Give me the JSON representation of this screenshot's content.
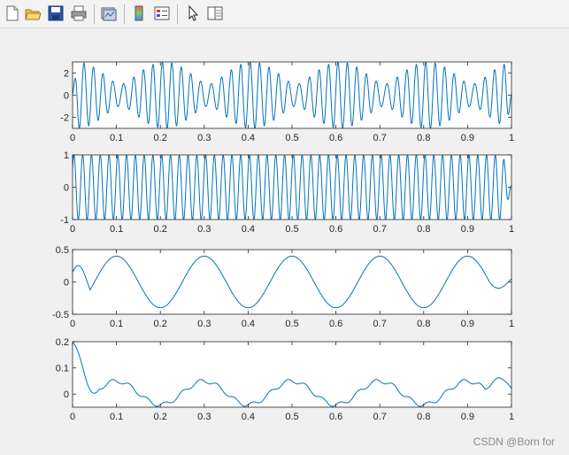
{
  "toolbar": {
    "buttons": [
      {
        "name": "new-figure-icon"
      },
      {
        "name": "open-file-icon"
      },
      {
        "name": "save-figure-icon"
      },
      {
        "name": "print-figure-icon"
      },
      {
        "name": "link-plot-icon"
      },
      {
        "name": "insert-colorbar-icon"
      },
      {
        "name": "insert-legend-icon"
      },
      {
        "name": "edit-plot-icon"
      },
      {
        "name": "open-property-inspector-icon"
      }
    ]
  },
  "watermark": "CSDN @Born for",
  "chart_data": [
    {
      "type": "line",
      "title": "",
      "xlabel": "",
      "ylabel": "",
      "xlim": [
        0,
        1
      ],
      "ylim": [
        -3,
        3
      ],
      "xticks": [
        0,
        0.1,
        0.2,
        0.3,
        0.4,
        0.5,
        0.6,
        0.7,
        0.8,
        0.9,
        1
      ],
      "xtick_labels": [
        "0",
        "0.1",
        "0.2",
        "0.3",
        "0.4",
        "0.5",
        "0.6",
        "0.7",
        "0.8",
        "0.9",
        "1"
      ],
      "yticks": [
        -2,
        0,
        2
      ],
      "ytick_labels": [
        "-2",
        "0",
        "2"
      ],
      "color": "#0072bd",
      "series": [
        {
          "description_of_signal": "sum of 50 Hz (amplitude 1) and 45 Hz (amplitude 2) sinusoids producing beats",
          "components": [
            {
              "frequency": 50,
              "amplitude": 1
            },
            {
              "frequency": 45,
              "amplitude": 2
            }
          ],
          "edge_taper": true
        }
      ]
    },
    {
      "type": "line",
      "title": "",
      "xlabel": "",
      "ylabel": "",
      "xlim": [
        0,
        1
      ],
      "ylim": [
        -1,
        1
      ],
      "xticks": [
        0,
        0.1,
        0.2,
        0.3,
        0.4,
        0.5,
        0.6,
        0.7,
        0.8,
        0.9,
        1
      ],
      "xtick_labels": [
        "0",
        "0.1",
        "0.2",
        "0.3",
        "0.4",
        "0.5",
        "0.6",
        "0.7",
        "0.8",
        "0.9",
        "1"
      ],
      "yticks": [
        -1,
        0,
        1
      ],
      "ytick_labels": [
        "-1",
        "0",
        "1"
      ],
      "color": "#0072bd",
      "series": [
        {
          "components": [
            {
              "frequency": 50,
              "amplitude": 1
            }
          ],
          "edge_taper": true
        }
      ]
    },
    {
      "type": "line",
      "title": "",
      "xlabel": "",
      "ylabel": "",
      "xlim": [
        0,
        1
      ],
      "ylim": [
        -0.5,
        0.5
      ],
      "xticks": [
        0,
        0.1,
        0.2,
        0.3,
        0.4,
        0.5,
        0.6,
        0.7,
        0.8,
        0.9,
        1
      ],
      "xtick_labels": [
        "0",
        "0.1",
        "0.2",
        "0.3",
        "0.4",
        "0.5",
        "0.6",
        "0.7",
        "0.8",
        "0.9",
        "1"
      ],
      "yticks": [
        -0.5,
        0,
        0.5
      ],
      "ytick_labels": [
        "-0.5",
        "0",
        "0.5"
      ],
      "color": "#0072bd",
      "series": [
        {
          "components": [
            {
              "frequency": 5,
              "amplitude": 0.4,
              "phase": -1.5708
            }
          ],
          "start_value": 0.15,
          "end_value": 0.05,
          "edge_taper": true
        }
      ]
    },
    {
      "type": "line",
      "title": "",
      "xlabel": "",
      "ylabel": "",
      "xlim": [
        0,
        1
      ],
      "ylim": [
        -0.05,
        0.2
      ],
      "xticks": [
        0,
        0.1,
        0.2,
        0.3,
        0.4,
        0.5,
        0.6,
        0.7,
        0.8,
        0.9,
        1
      ],
      "xtick_labels": [
        "0",
        "0.1",
        "0.2",
        "0.3",
        "0.4",
        "0.5",
        "0.6",
        "0.7",
        "0.8",
        "0.9",
        "1"
      ],
      "yticks": [
        0,
        0.1,
        0.2
      ],
      "ytick_labels": [
        "0",
        "0.1",
        "0.2"
      ],
      "color": "#0072bd",
      "series": [
        {
          "description_of_signal": "residual: periodic bumps peaking ~0.05 at 0.2,0.4,0.6,0.8 and dips ~-0.04 at 0.1,0.3,0.5,0.7,0.9",
          "peaks_x": [
            0.2,
            0.4,
            0.6,
            0.8
          ],
          "peak_value": 0.05,
          "trough_value": -0.04,
          "start_value": 0.2,
          "end_value": 0.0
        }
      ]
    }
  ]
}
